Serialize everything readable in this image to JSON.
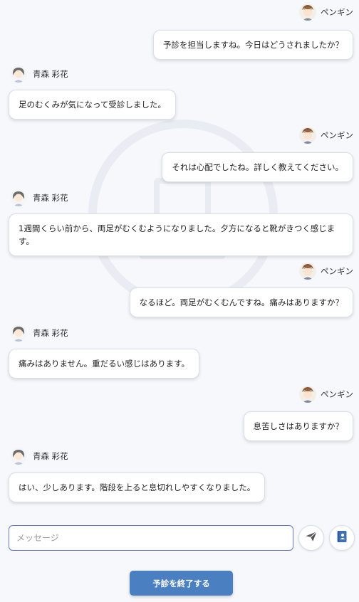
{
  "speakers": {
    "doctor": "ペンギン",
    "patient": "青森 彩花"
  },
  "messages": [
    {
      "from": "doctor",
      "text": "予診を担当しますね。今日はどうされましたか？"
    },
    {
      "from": "patient",
      "text": "足のむくみが気になって受診しました。"
    },
    {
      "from": "doctor",
      "text": "それは心配でしたね。詳しく教えてください。"
    },
    {
      "from": "patient",
      "text": "1週間くらい前から、両足がむくむようになりました。夕方になると靴がきつく感じます。"
    },
    {
      "from": "doctor",
      "text": "なるほど。両足がむくむんですね。痛みはありますか？"
    },
    {
      "from": "patient",
      "text": "痛みはありません。重だるい感じはあります。"
    },
    {
      "from": "doctor",
      "text": "息苦しさはありますか？"
    },
    {
      "from": "patient",
      "text": "はい、少しあります。階段を上ると息切れしやすくなりました。"
    }
  ],
  "composer": {
    "placeholder": "メッセージ"
  },
  "actions": {
    "end_label": "予診を終了する"
  },
  "icons": {
    "send": "send-icon",
    "record": "notebook-icon"
  },
  "colors": {
    "primary": "#4a7fc1",
    "input_border": "#6677cc",
    "record_icon": "#3f6fb3"
  }
}
